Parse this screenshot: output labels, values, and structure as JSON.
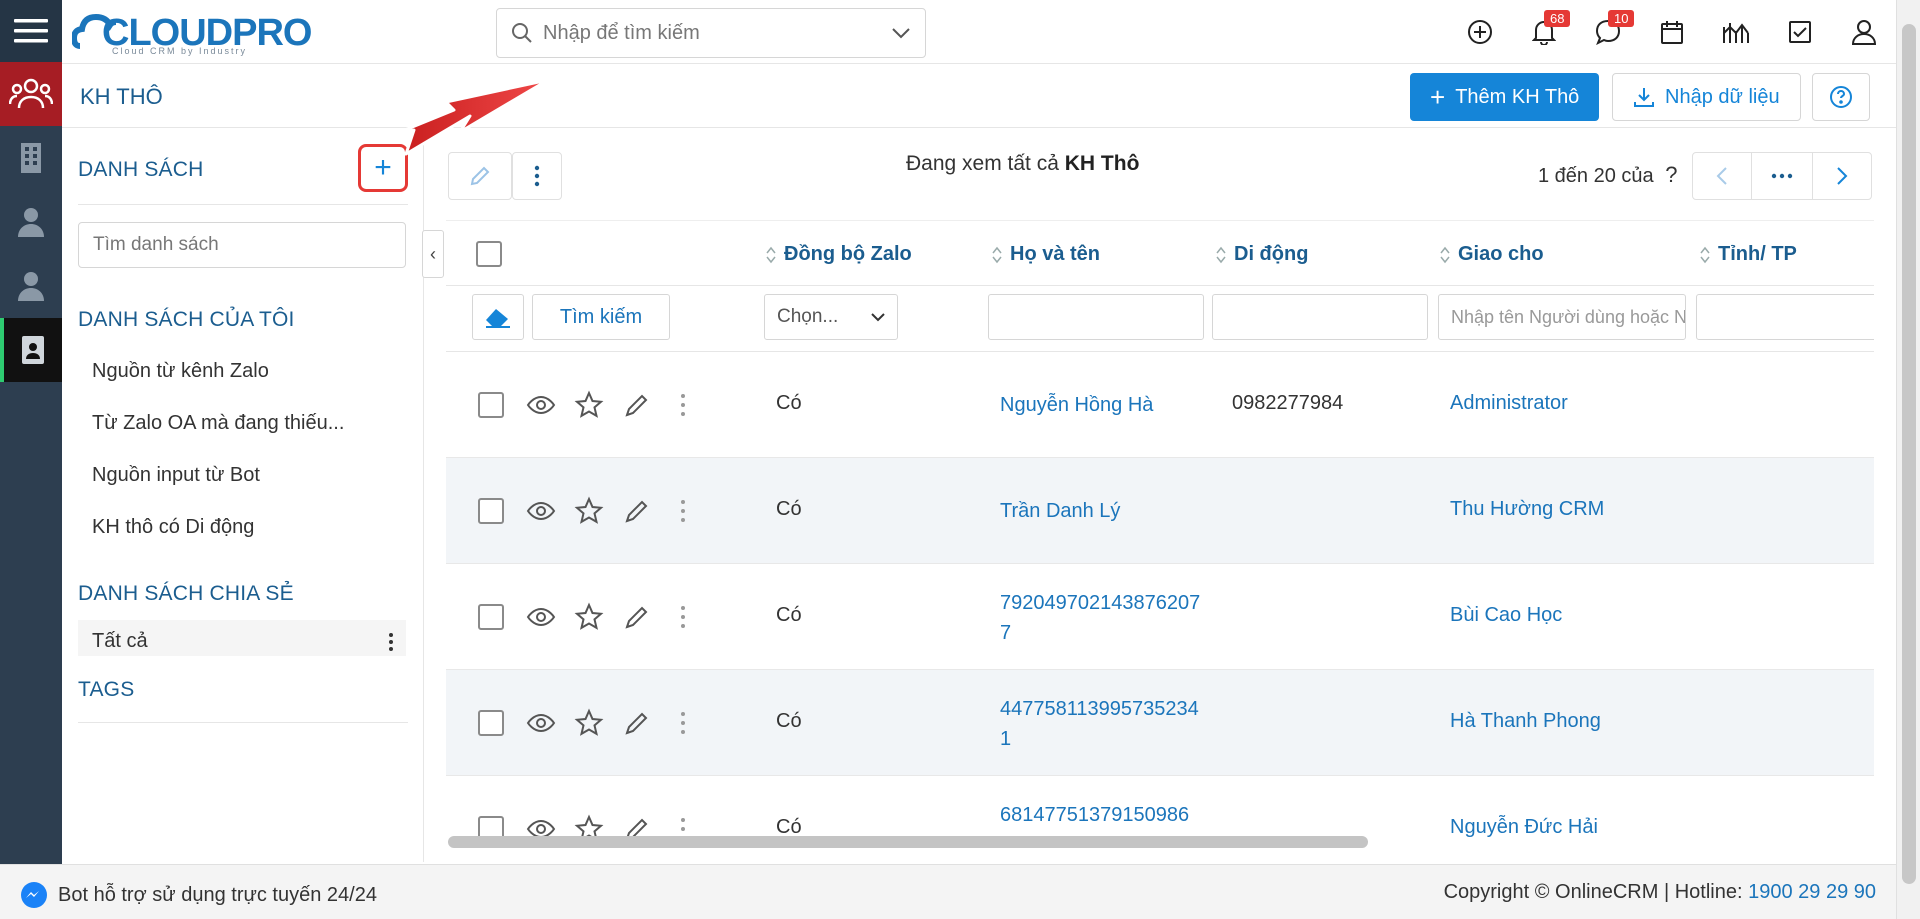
{
  "app": {
    "logo_text": "CLOUDPRO",
    "logo_tagline": "Cloud CRM by Industry",
    "search_placeholder": "Nhập để tìm kiếm",
    "notifications_count": "68",
    "messages_count": "10"
  },
  "page": {
    "title": "KH THÔ",
    "add_button": "Thêm KH Thô",
    "import_button": "Nhập dữ liệu"
  },
  "sidebar": {
    "lists_title": "DANH SÁCH",
    "search_placeholder": "Tìm danh sách",
    "my_lists_title": "DANH SÁCH CỦA TÔI",
    "my_lists": [
      "Nguồn từ kênh Zalo",
      "Từ Zalo OA mà đang thiếu...",
      "Nguồn input từ Bot",
      "KH thô có Di động"
    ],
    "shared_title": "DANH SÁCH CHIA SẺ",
    "shared_item": "Tất cả",
    "tags_title": "TAGS"
  },
  "main": {
    "viewing_prefix": "Đang xem tất cả",
    "viewing_module": "KH Thô",
    "pager_text": "1 đến 20 của",
    "pager_unknown": "?",
    "search_button": "Tìm kiếm",
    "zalo_filter": "Chọn...",
    "assignee_placeholder": "Nhập tên Người dùng hoặc Nhóm",
    "columns": [
      "Đồng bộ Zalo",
      "Họ và tên",
      "Di động",
      "Giao cho",
      "Tỉnh/ TP"
    ],
    "rows": [
      {
        "zalo": "Có",
        "name": "Nguyễn Hồng Hà",
        "mobile": "0982277984",
        "assignee": "Administrator"
      },
      {
        "zalo": "Có",
        "name": "Trần Danh Lý",
        "mobile": "",
        "assignee": "Thu Hường CRM"
      },
      {
        "zalo": "Có",
        "name": "7920497021438762077",
        "mobile": "",
        "assignee": "Bùi Cao Học"
      },
      {
        "zalo": "Có",
        "name": "4477581139957352341",
        "mobile": "",
        "assignee": "Hà Thanh Phong"
      },
      {
        "zalo": "Có",
        "name": "68147751379150986",
        "mobile": "",
        "assignee": "Nguyễn Đức Hải"
      }
    ]
  },
  "footer": {
    "bot_text": "Bot hỗ trợ sử dụng trực tuyến 24/24",
    "copyright": "Copyright © OnlineCRM",
    "hotline_label": "Hotline:",
    "hotline": "1900 29 29 90"
  },
  "colors": {
    "rail": "#2d3e50",
    "primary": "#1585d8",
    "heading": "#1b5d8f",
    "annotation": "#e53935"
  }
}
